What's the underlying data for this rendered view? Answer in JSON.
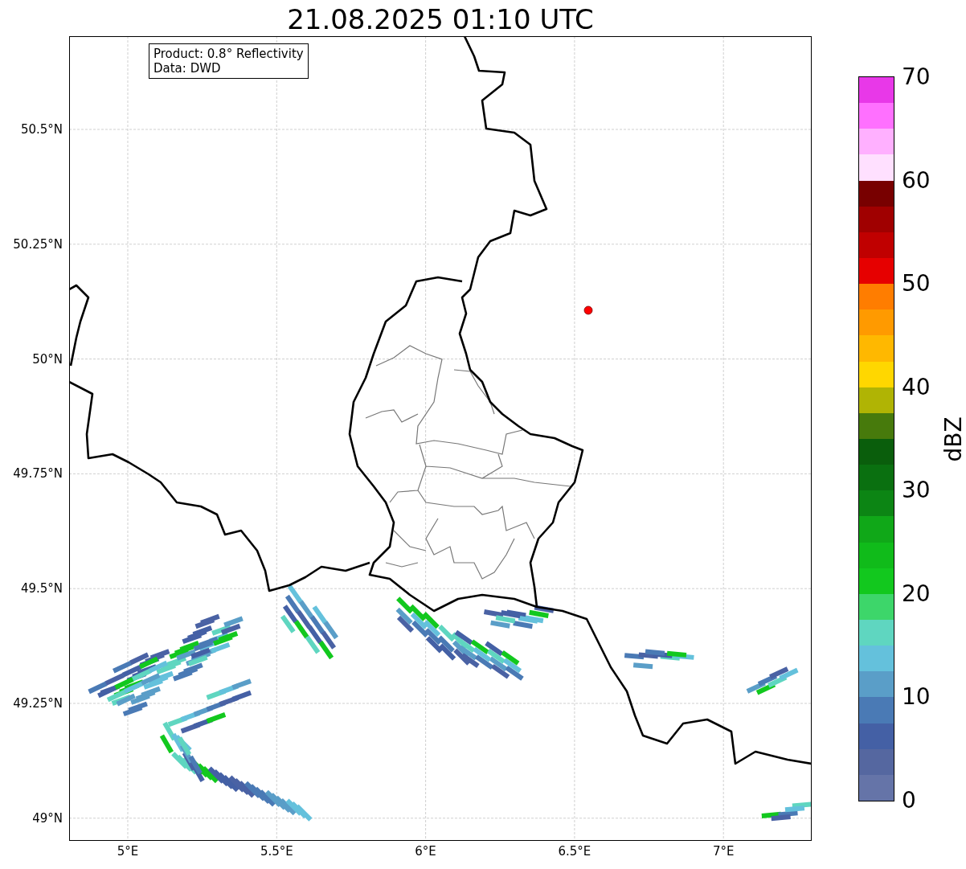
{
  "title": "21.08.2025 01:10 UTC",
  "legend": [
    "Product: 0.8° Reflectivity",
    "Data: DWD"
  ],
  "map": {
    "lat_ticks": [
      "50.5°N",
      "50.25°N",
      "50°N",
      "49.75°N",
      "49.5°N",
      "49.25°N",
      "49°N"
    ],
    "lon_ticks": [
      "5°E",
      "5.5°E",
      "6°E",
      "6.5°E",
      "7°E"
    ]
  },
  "colorbar": {
    "label": "dBZ",
    "ticks": [
      "70",
      "60",
      "50",
      "40",
      "30",
      "20",
      "10",
      "0"
    ],
    "segments": [
      {
        "color": "#6574a8"
      },
      {
        "color": "#5567a0"
      },
      {
        "color": "#4460a5"
      },
      {
        "color": "#4a7ab5"
      },
      {
        "color": "#5a9ec8"
      },
      {
        "color": "#64c1dc"
      },
      {
        "color": "#5fd6c0"
      },
      {
        "color": "#3dd66a"
      },
      {
        "color": "#12c81e"
      },
      {
        "color": "#10bb1a"
      },
      {
        "color": "#10a818"
      },
      {
        "color": "#0c8514"
      },
      {
        "color": "#0a7010"
      },
      {
        "color": "#0a5e0c"
      },
      {
        "color": "#477a0c"
      },
      {
        "color": "#b0b404"
      },
      {
        "color": "#ffd700"
      },
      {
        "color": "#ffb800"
      },
      {
        "color": "#ff9a00"
      },
      {
        "color": "#ff7d00"
      },
      {
        "color": "#e60000"
      },
      {
        "color": "#c00000"
      },
      {
        "color": "#a00000"
      },
      {
        "color": "#780000"
      },
      {
        "color": "#ffe0ff"
      },
      {
        "color": "#ffb0ff"
      },
      {
        "color": "#ff70ff"
      },
      {
        "color": "#e838e8"
      }
    ]
  }
}
